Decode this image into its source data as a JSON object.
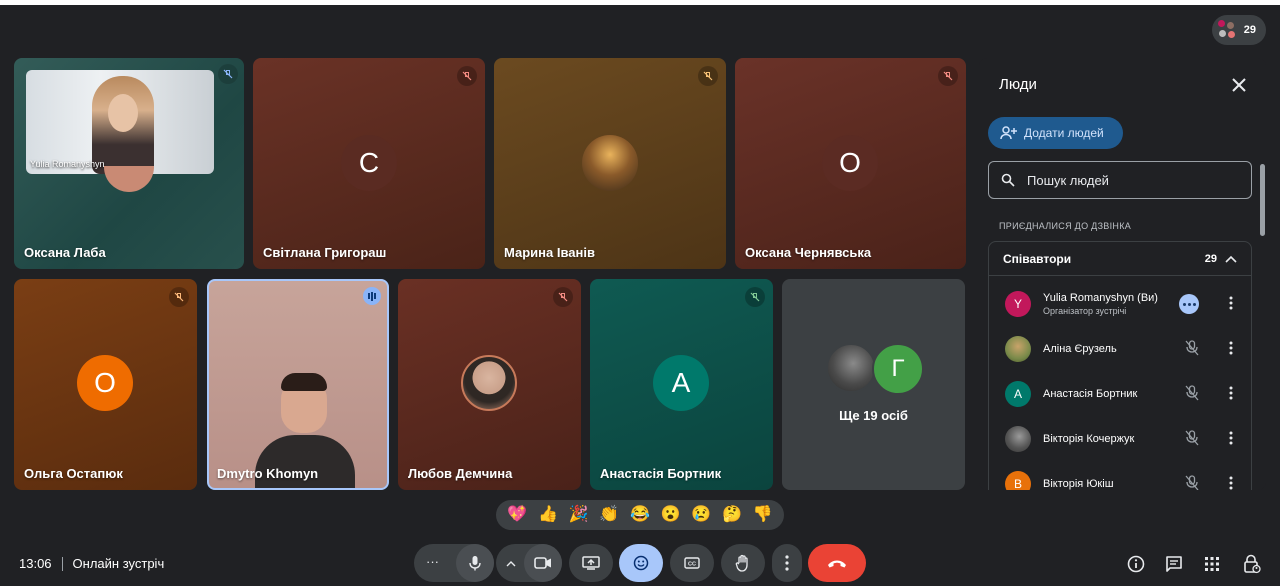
{
  "top_bar": {
    "participant_count": "29"
  },
  "tiles": [
    {
      "name": "Оксана Лаба",
      "overlay_label": "Yulia Romanyshyn"
    },
    {
      "name": "Світлана Григораш",
      "initial": "С"
    },
    {
      "name": "Марина Іванів"
    },
    {
      "name": "Оксана Чернявська",
      "initial": "О"
    },
    {
      "name": "Ольга Остапюк",
      "initial": "О"
    },
    {
      "name": "Dmytro Khomyn"
    },
    {
      "name": "Любов Демчина"
    },
    {
      "name": "Анастасія Бортник",
      "initial": "А"
    },
    {
      "more_label": "Ще 19 осіб",
      "initial": "Г"
    }
  ],
  "panel": {
    "title": "Люди",
    "add_people": "Додати людей",
    "search_placeholder": "Пошук людей",
    "section_label": "ПРИЄДНАЛИСЯ ДО ДЗВІНКА",
    "group_title": "Співавтори",
    "group_count": "29",
    "people": [
      {
        "initial": "Y",
        "name": "Yulia Romanyshyn (Ви)",
        "role": "Організатор зустрічі",
        "color": "#c2185b"
      },
      {
        "initial": "",
        "name": "Аліна Єрузель",
        "role": "",
        "color": "#7a8a4a"
      },
      {
        "initial": "А",
        "name": "Анастасія Бортник",
        "role": "",
        "color": "#00796b"
      },
      {
        "initial": "",
        "name": "Вікторія Кочержук",
        "role": "",
        "color": "#5f6368"
      },
      {
        "initial": "В",
        "name": "Вікторія Юкіш",
        "role": "",
        "color": "#e8710a"
      }
    ]
  },
  "reactions": [
    "💖",
    "👍",
    "🎉",
    "👏",
    "😂",
    "😮",
    "😢",
    "🤔",
    "👎"
  ],
  "footer": {
    "time": "13:06",
    "meeting_title": "Онлайн зустріч"
  },
  "colors": {
    "accent": "#8ab4f8",
    "end_call": "#ea4335",
    "active_control": "#a8c7fa"
  }
}
